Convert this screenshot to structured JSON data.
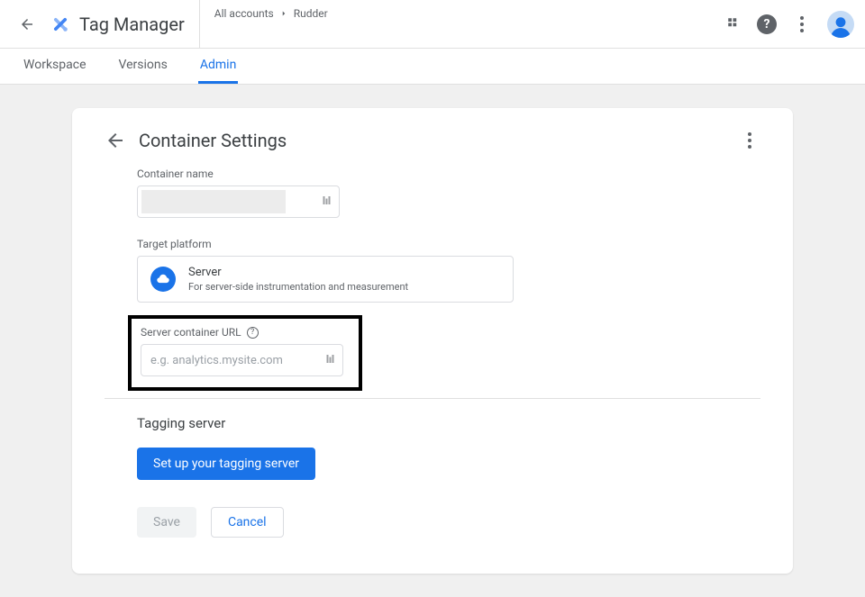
{
  "header": {
    "app_title": "Tag Manager",
    "breadcrumb_prefix": "All accounts",
    "breadcrumb_account": "Rudder"
  },
  "tabs": {
    "workspace": "Workspace",
    "versions": "Versions",
    "admin": "Admin"
  },
  "card": {
    "title": "Container Settings",
    "container_name_label": "Container name",
    "container_name_value": "",
    "target_platform_label": "Target platform",
    "platform_name": "Server",
    "platform_desc": "For server-side instrumentation and measurement",
    "server_url_label": "Server container URL",
    "server_url_placeholder": "e.g. analytics.mysite.com",
    "server_url_value": "",
    "tagging_server_title": "Tagging server",
    "setup_button": "Set up your tagging server",
    "save": "Save",
    "cancel": "Cancel"
  }
}
